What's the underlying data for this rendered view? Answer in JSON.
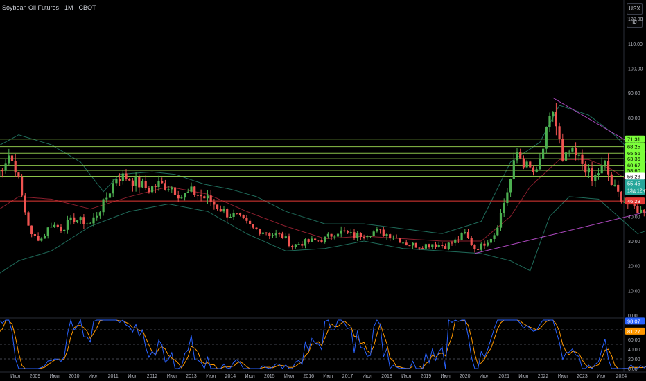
{
  "header": {
    "title": "Soybean Oil Futures · 1M · CBOT"
  },
  "axis_controls": {
    "currency": "USX",
    "unit": "lb"
  },
  "colors": {
    "up": "#26a69a",
    "up_body": "#4caf50",
    "down": "#ef5350",
    "level_line": "#8bc34a",
    "support_line": "#e53935",
    "trendline": "#ab47bc",
    "bollinger": "#1f6b5a",
    "sma": "#8b1e2d",
    "stoch_k": "#2962ff",
    "stoch_d": "#ff9800"
  },
  "chart_data": {
    "type": "candlestick",
    "timeframe": "1M",
    "x_start": "2008-01",
    "x_end": "2026-07",
    "x_tick_labels": [
      "008",
      "Июл",
      "2009",
      "Июл",
      "2010",
      "Июл",
      "2011",
      "Июл",
      "2012",
      "Июл",
      "2013",
      "Июл",
      "2014",
      "Июл",
      "2015",
      "Июл",
      "2016",
      "Июл",
      "2017",
      "Июл",
      "2018",
      "Июл",
      "2019",
      "Июл",
      "2020",
      "Июл",
      "2021",
      "Июл",
      "2022",
      "Июл",
      "2023",
      "Июл",
      "2024",
      "Июл",
      "2025",
      "Июл",
      "2026"
    ],
    "y_range": [
      0,
      122
    ],
    "y_ticks": [
      "120,00",
      "110,00",
      "100,00",
      "90,00",
      "80,00",
      "70,00",
      "60,00",
      "50,00",
      "40,00",
      "30,00",
      "20,00",
      "10,00",
      "0,00"
    ],
    "anchors": [
      [
        "2008-01",
        56
      ],
      [
        "2008-05",
        65
      ],
      [
        "2008-07",
        60
      ],
      [
        "2008-10",
        42
      ],
      [
        "2008-12",
        32
      ],
      [
        "2009-03",
        31
      ],
      [
        "2009-06",
        37
      ],
      [
        "2009-09",
        35
      ],
      [
        "2010-01",
        39
      ],
      [
        "2010-06",
        37
      ],
      [
        "2010-10",
        45
      ],
      [
        "2011-02",
        56
      ],
      [
        "2011-05",
        56
      ],
      [
        "2011-09",
        53
      ],
      [
        "2011-12",
        51
      ],
      [
        "2012-03",
        53
      ],
      [
        "2012-07",
        52
      ],
      [
        "2012-10",
        48
      ],
      [
        "2013-01",
        50
      ],
      [
        "2013-06",
        47
      ],
      [
        "2013-12",
        41
      ],
      [
        "2014-03",
        40
      ],
      [
        "2014-08",
        35
      ],
      [
        "2014-11",
        34
      ],
      [
        "2015-01",
        33
      ],
      [
        "2015-05",
        32
      ],
      [
        "2015-08",
        28
      ],
      [
        "2015-10",
        29
      ],
      [
        "2016-02",
        30
      ],
      [
        "2016-06",
        31
      ],
      [
        "2016-10",
        34
      ],
      [
        "2017-01",
        33
      ],
      [
        "2017-03",
        32
      ],
      [
        "2017-06",
        33
      ],
      [
        "2017-10",
        34
      ],
      [
        "2018-03",
        32
      ],
      [
        "2018-07",
        29
      ],
      [
        "2018-11",
        28
      ],
      [
        "2019-03",
        29
      ],
      [
        "2019-07",
        28
      ],
      [
        "2019-10",
        30
      ],
      [
        "2020-01",
        33
      ],
      [
        "2020-04",
        27
      ],
      [
        "2020-06",
        28
      ],
      [
        "2020-10",
        33
      ],
      [
        "2020-12",
        41
      ],
      [
        "2021-03",
        55
      ],
      [
        "2021-05",
        66
      ],
      [
        "2021-08",
        60
      ],
      [
        "2021-11",
        57
      ],
      [
        "2022-02",
        73
      ],
      [
        "2022-04",
        83
      ],
      [
        "2022-06",
        70
      ],
      [
        "2022-07",
        61
      ],
      [
        "2022-09",
        66
      ],
      [
        "2022-12",
        63
      ],
      [
        "2023-02",
        60
      ],
      [
        "2023-04",
        54
      ],
      [
        "2023-06",
        58
      ],
      [
        "2023-08",
        61
      ],
      [
        "2023-10",
        53
      ],
      [
        "2023-12",
        49
      ],
      [
        "2024-03",
        45
      ],
      [
        "2024-07",
        42
      ],
      [
        "2024-09",
        44
      ],
      [
        "2024-12",
        43
      ],
      [
        "2025-02",
        44
      ],
      [
        "2025-04",
        48
      ],
      [
        "2025-05",
        55.45
      ]
    ],
    "bollinger_top_anchors": [
      [
        "2008-01",
        68
      ],
      [
        "2008-08",
        73
      ],
      [
        "2009-06",
        69
      ],
      [
        "2010-03",
        62
      ],
      [
        "2010-10",
        50
      ],
      [
        "2011-03",
        57
      ],
      [
        "2012-01",
        58
      ],
      [
        "2012-08",
        57
      ],
      [
        "2013-05",
        53
      ],
      [
        "2014-01",
        51
      ],
      [
        "2014-09",
        48
      ],
      [
        "2015-06",
        42
      ],
      [
        "2016-06",
        37
      ],
      [
        "2017-06",
        37
      ],
      [
        "2018-06",
        35
      ],
      [
        "2019-06",
        33
      ],
      [
        "2020-06",
        38
      ],
      [
        "2021-03",
        62
      ],
      [
        "2021-12",
        70
      ],
      [
        "2022-06",
        85
      ],
      [
        "2023-03",
        81
      ],
      [
        "2023-10",
        74
      ],
      [
        "2024-06",
        64
      ],
      [
        "2025-05",
        55
      ]
    ],
    "bollinger_bottom_anchors": [
      [
        "2008-01",
        16
      ],
      [
        "2008-08",
        22
      ],
      [
        "2009-06",
        26
      ],
      [
        "2010-06",
        36
      ],
      [
        "2011-06",
        42
      ],
      [
        "2012-06",
        45
      ],
      [
        "2013-06",
        42
      ],
      [
        "2014-06",
        33
      ],
      [
        "2015-06",
        26
      ],
      [
        "2016-06",
        27
      ],
      [
        "2017-06",
        30
      ],
      [
        "2018-06",
        27
      ],
      [
        "2019-06",
        26
      ],
      [
        "2020-06",
        25
      ],
      [
        "2021-03",
        22
      ],
      [
        "2021-09",
        18
      ],
      [
        "2022-03",
        40
      ],
      [
        "2022-09",
        48
      ],
      [
        "2023-06",
        47
      ],
      [
        "2024-06",
        33
      ],
      [
        "2025-03",
        37
      ],
      [
        "2025-05",
        39
      ]
    ],
    "sma_anchors": [
      [
        "2008-01",
        42
      ],
      [
        "2008-08",
        48
      ],
      [
        "2009-06",
        47
      ],
      [
        "2010-06",
        43
      ],
      [
        "2011-06",
        48
      ],
      [
        "2012-06",
        52
      ],
      [
        "2013-06",
        49
      ],
      [
        "2014-06",
        42
      ],
      [
        "2015-06",
        36
      ],
      [
        "2016-06",
        31
      ],
      [
        "2017-06",
        32
      ],
      [
        "2018-06",
        31
      ],
      [
        "2019-06",
        30
      ],
      [
        "2020-06",
        30
      ],
      [
        "2021-03",
        40
      ],
      [
        "2021-09",
        52
      ],
      [
        "2022-06",
        63
      ],
      [
        "2023-03",
        63
      ],
      [
        "2023-10",
        59
      ],
      [
        "2024-06",
        52
      ],
      [
        "2025-05",
        47
      ]
    ],
    "horizontal_levels": [
      71.31,
      68.25,
      65.56,
      63.36,
      60.67,
      58.6,
      56.23
    ],
    "support_level": 46.23,
    "trendline_upper": [
      [
        "2022-04",
        88
      ],
      [
        "2026-04",
        51
      ]
    ],
    "trendline_lower": [
      [
        "2020-04",
        25
      ],
      [
        "2026-04",
        48
      ]
    ],
    "price_labels": {
      "levels": [
        "71,31",
        "68,25",
        "65,56",
        "63,36",
        "60,67",
        "58,60",
        "56,23"
      ],
      "current": "55,45",
      "countdown": "13д 12ч",
      "support": "46,23"
    },
    "stochastic": {
      "k_last": 98.07,
      "d_last": 81.27,
      "k_label": "98,07",
      "d_label": "81,27",
      "y_ticks": [
        "80,00",
        "60,00",
        "40,00",
        "20,00",
        "0,00"
      ],
      "bands": [
        80,
        50,
        20
      ]
    }
  }
}
